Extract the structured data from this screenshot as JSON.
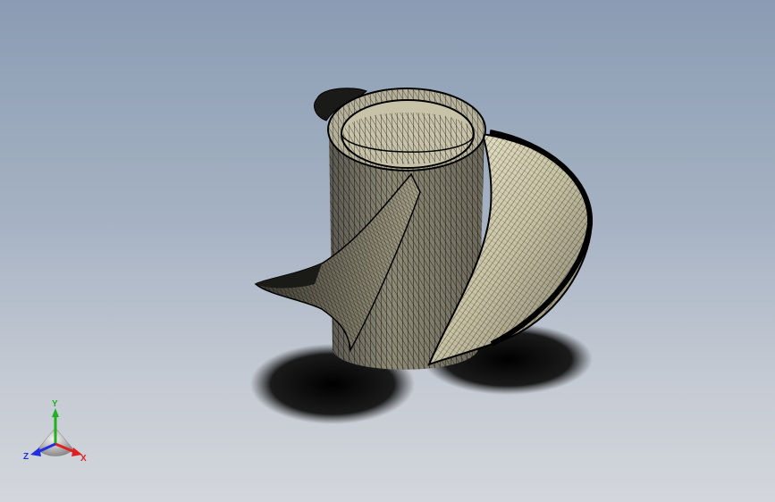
{
  "viewport": {
    "background_top": "#8a9cb3",
    "background_bottom": "#d3d6dc"
  },
  "model": {
    "name": "propeller-mesh",
    "fill_color": "#a9a48c",
    "mesh_color": "#000000",
    "shadow_color": "#0b0b0b"
  },
  "triad": {
    "x_label": "X",
    "y_label": "Y",
    "z_label": "Z",
    "x_color": "#e02020",
    "y_color": "#20b020",
    "z_color": "#2030e0"
  }
}
